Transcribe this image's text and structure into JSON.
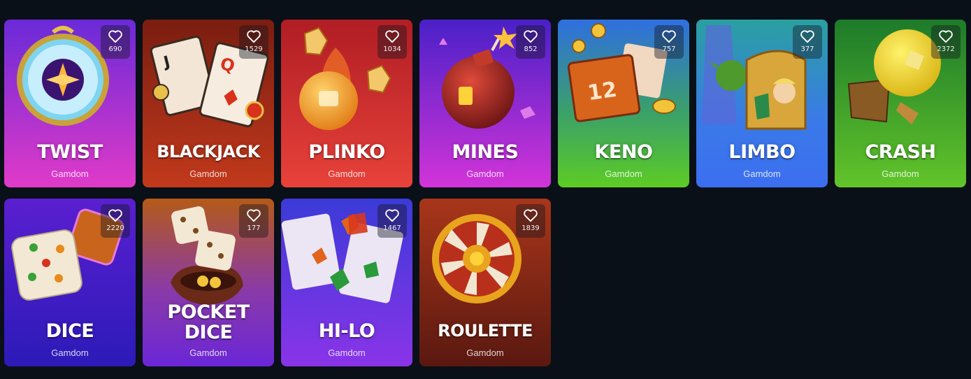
{
  "games": [
    {
      "id": "twist",
      "title": "TWIST",
      "provider": "Gamdom",
      "favorites": "690",
      "colors": {
        "top": "#6a2ad8",
        "bottom": "#e03ac8"
      }
    },
    {
      "id": "blackjack",
      "title": "BLACKJACK",
      "provider": "Gamdom",
      "favorites": "1529",
      "colors": {
        "top": "#7a1d10",
        "bottom": "#c2391c"
      }
    },
    {
      "id": "plinko",
      "title": "PLINKO",
      "provider": "Gamdom",
      "favorites": "1034",
      "colors": {
        "top": "#b01d24",
        "bottom": "#e8423a"
      }
    },
    {
      "id": "mines",
      "title": "MINES",
      "provider": "Gamdom",
      "favorites": "852",
      "colors": {
        "top": "#4a20c8",
        "bottom": "#d234d8"
      }
    },
    {
      "id": "keno",
      "title": "KENO",
      "provider": "Gamdom",
      "favorites": "757",
      "colors": {
        "top": "#2f6fe0",
        "bottom": "#5dcc24"
      }
    },
    {
      "id": "limbo",
      "title": "LIMBO",
      "provider": "Gamdom",
      "favorites": "377",
      "colors": {
        "top": "#2aa0a0",
        "bottom": "#3c6ef0"
      }
    },
    {
      "id": "crash",
      "title": "CRASH",
      "provider": "Gamdom",
      "favorites": "2372",
      "colors": {
        "top": "#1d7a2a",
        "bottom": "#62c52a"
      }
    },
    {
      "id": "dice",
      "title": "DICE",
      "provider": "Gamdom",
      "favorites": "2220",
      "colors": {
        "top": "#5a1fd0",
        "bottom": "#2c1ab8"
      }
    },
    {
      "id": "pocket-dice",
      "title": "POCKET DICE",
      "provider": "Gamdom",
      "favorites": "177",
      "colors": {
        "top": "#b45a18",
        "bottom": "#6a26d8"
      }
    },
    {
      "id": "hi-lo",
      "title": "HI-LO",
      "provider": "Gamdom",
      "favorites": "1467",
      "colors": {
        "top": "#3b3ad8",
        "bottom": "#8a34e8"
      }
    },
    {
      "id": "roulette",
      "title": "ROULETTE",
      "provider": "Gamdom",
      "favorites": "1839",
      "colors": {
        "top": "#a8361a",
        "bottom": "#5a1810"
      }
    }
  ],
  "icons": {
    "favorite": "heart-outline-icon"
  }
}
